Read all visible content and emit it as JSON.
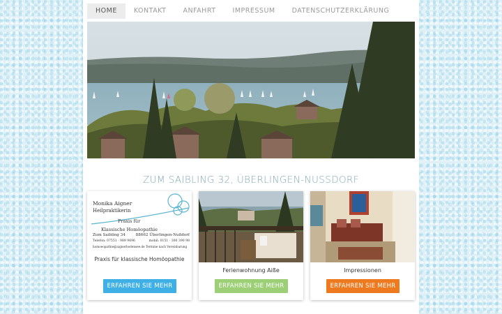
{
  "nav": {
    "items": [
      {
        "label": "HOME",
        "active": true
      },
      {
        "label": "KONTAKT",
        "active": false
      },
      {
        "label": "ANFAHRT",
        "active": false
      },
      {
        "label": "IMPRESSUM",
        "active": false
      },
      {
        "label": "DATENSCHUTZERKLÄRUNG",
        "active": false
      }
    ]
  },
  "hero": {
    "description_icon": "lake-landscape-image"
  },
  "address_heading": "ZUM SAIBLING 32, ÜBERLINGEN-NUSSDORF",
  "business_card": {
    "name": "Monika Aigner",
    "profession": "Heilpraktikerin",
    "praxis_line1": "Praxis für",
    "praxis_line2": "Klassische Homöopathie",
    "street": "Zum Saibling 34",
    "city": "88662 Überlingen-Nußdorf",
    "phone": "Telefon: 07551 · 989 9696",
    "mobile": "mobil: 0151 · 300 390 98",
    "email": "homoeopathie@aignerbodensee.de Termine nach Vereinbarung",
    "tagline": "Praxis für klassische Homöopathie"
  },
  "cards": [
    {
      "caption": "",
      "button_label": "ERFAHREN SIE MEHR",
      "button_color": "#3fb0e6"
    },
    {
      "caption": "Ferienwohnung Aiße",
      "button_label": "ERFAHREN SIE MEHR",
      "button_color": "#9ccf76"
    },
    {
      "caption": "Impressionen",
      "button_label": "ERFAHREN SIE MEHR",
      "button_color": "#ee7a1f"
    }
  ]
}
